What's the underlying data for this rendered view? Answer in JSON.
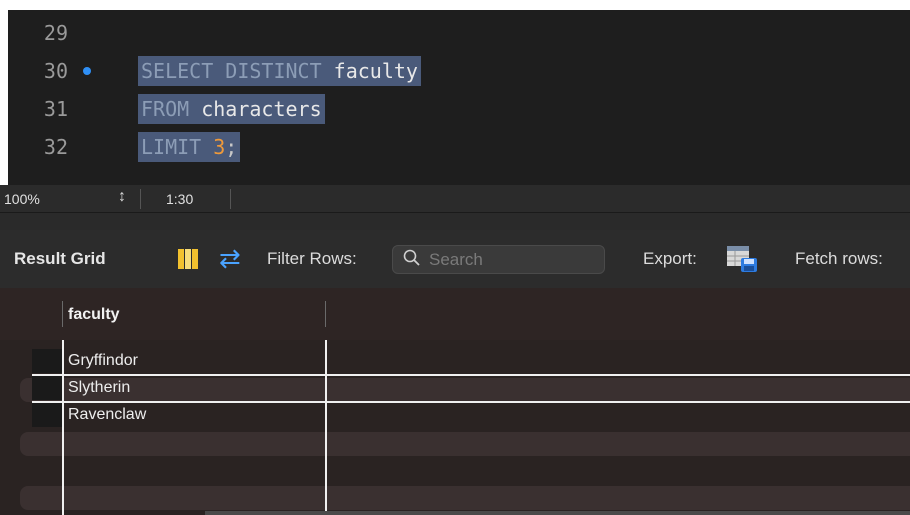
{
  "editor": {
    "lines": [
      {
        "number": "29",
        "has_marker": false,
        "tokens": []
      },
      {
        "number": "30",
        "has_marker": true,
        "tokens": [
          {
            "text": "SELECT DISTINCT ",
            "kind": "kw"
          },
          {
            "text": "faculty",
            "kind": "ident"
          }
        ]
      },
      {
        "number": "31",
        "has_marker": false,
        "tokens": [
          {
            "text": "FROM ",
            "kind": "kw"
          },
          {
            "text": "characters",
            "kind": "ident"
          }
        ]
      },
      {
        "number": "32",
        "has_marker": false,
        "tokens": [
          {
            "text": "LIMIT ",
            "kind": "kw"
          },
          {
            "text": "3",
            "kind": "num"
          },
          {
            "text": ";",
            "kind": "punct"
          }
        ]
      }
    ]
  },
  "statusbar": {
    "zoom": "100%",
    "cursor_position": "1:30"
  },
  "toolbar": {
    "title": "Result Grid",
    "filter_label": "Filter Rows:",
    "search_placeholder": "Search",
    "export_label": "Export:",
    "fetch_label": "Fetch rows:"
  },
  "grid": {
    "columns": [
      "faculty"
    ],
    "rows": [
      "Gryffindor",
      "Slytherin",
      "Ravenclaw"
    ]
  },
  "colors": {
    "keyword": "#8c9db6",
    "selection": "#4a5a7a",
    "number": "#ef9a3a",
    "accent_blue": "#2f8ff5"
  }
}
